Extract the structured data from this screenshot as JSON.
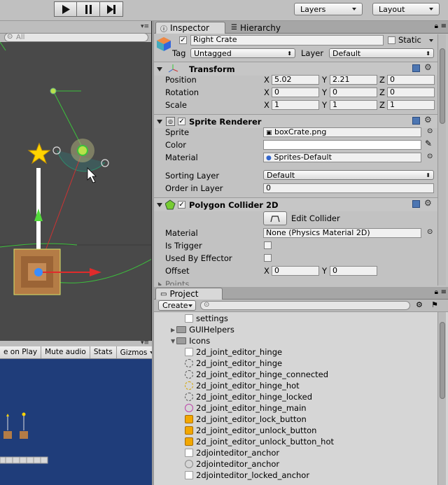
{
  "toolbar": {
    "layers_label": "Layers",
    "layout_label": "Layout"
  },
  "scene": {
    "search_placeholder": "All"
  },
  "game": {
    "buttons": [
      "e on Play",
      "Mute audio",
      "Stats",
      "Gizmos"
    ]
  },
  "inspector": {
    "tabs": [
      "Inspector",
      "Hierarchy"
    ],
    "object_name": "Right Crate",
    "static_label": "Static",
    "tag_label": "Tag",
    "tag_value": "Untagged",
    "layer_label": "Layer",
    "layer_value": "Default",
    "transform": {
      "title": "Transform",
      "position_label": "Position",
      "rotation_label": "Rotation",
      "scale_label": "Scale",
      "axis": [
        "X",
        "Y",
        "Z"
      ],
      "position": [
        "5.02",
        "2.21",
        "0"
      ],
      "rotation": [
        "0",
        "0",
        "0"
      ],
      "scale": [
        "1",
        "1",
        "1"
      ]
    },
    "sprite_renderer": {
      "title": "Sprite Renderer",
      "sprite_label": "Sprite",
      "sprite_value": "boxCrate.png",
      "color_label": "Color",
      "material_label": "Material",
      "material_value": "Sprites-Default",
      "sorting_layer_label": "Sorting Layer",
      "sorting_layer_value": "Default",
      "order_label": "Order in Layer",
      "order_value": "0"
    },
    "polygon_collider": {
      "title": "Polygon Collider 2D",
      "edit_label": "Edit Collider",
      "material_label": "Material",
      "material_value": "None (Physics Material 2D)",
      "trigger_label": "Is Trigger",
      "effector_label": "Used By Effector",
      "offset_label": "Offset",
      "offset_x": "0",
      "offset_y": "0",
      "points_label": "Points"
    }
  },
  "project": {
    "tab": "Project",
    "create_label": "Create",
    "items": [
      {
        "label": "settings",
        "indent": 3,
        "kind": "file"
      },
      {
        "label": "GUIHelpers",
        "indent": 1,
        "kind": "folder-closed"
      },
      {
        "label": "Icons",
        "indent": 1,
        "kind": "folder-open"
      },
      {
        "label": "2d_joint_editor_hinge",
        "indent": 2,
        "kind": "file"
      },
      {
        "label": "2d_joint_editor_hinge",
        "indent": 2,
        "kind": "icon-dotted"
      },
      {
        "label": "2d_joint_editor_hinge_connected",
        "indent": 2,
        "kind": "icon-dotted"
      },
      {
        "label": "2d_joint_editor_hinge_hot",
        "indent": 2,
        "kind": "icon-yellow"
      },
      {
        "label": "2d_joint_editor_hinge_locked",
        "indent": 2,
        "kind": "icon-dotted"
      },
      {
        "label": "2d_joint_editor_hinge_main",
        "indent": 2,
        "kind": "icon-pink"
      },
      {
        "label": "2d_joint_editor_lock_button",
        "indent": 2,
        "kind": "icon-lock"
      },
      {
        "label": "2d_joint_editor_unlock_button",
        "indent": 2,
        "kind": "icon-lock"
      },
      {
        "label": "2d_joint_editor_unlock_button_hot",
        "indent": 2,
        "kind": "icon-lock"
      },
      {
        "label": "2djointeditor_anchor",
        "indent": 2,
        "kind": "file"
      },
      {
        "label": "2djointeditor_anchor",
        "indent": 2,
        "kind": "icon-cross"
      },
      {
        "label": "2djointeditor_locked_anchor",
        "indent": 2,
        "kind": "file"
      }
    ]
  }
}
